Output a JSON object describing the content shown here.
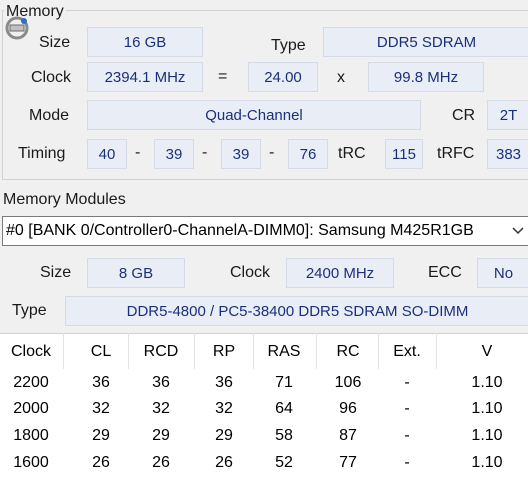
{
  "memory": {
    "title": "Memory",
    "size_label": "Size",
    "size_value": "16 GB",
    "type_label": "Type",
    "type_value": "DDR5 SDRAM",
    "clock_label": "Clock",
    "clock_value": "2394.1 MHz",
    "equals": "=",
    "multiplier": "24.00",
    "times": "x",
    "bus": "99.8 MHz",
    "mode_label": "Mode",
    "mode_value": "Quad-Channel",
    "cr_label": "CR",
    "cr_value": "2T",
    "timing_label": "Timing",
    "timings": [
      "40",
      "39",
      "39",
      "76"
    ],
    "dash": "-",
    "trc_label": "tRC",
    "trc_value": "115",
    "trfc_label": "tRFC",
    "trfc_value": "383"
  },
  "modules": {
    "title": "Memory Modules",
    "selected": "#0 [BANK 0/Controller0-ChannelA-DIMM0]: Samsung M425R1GB",
    "size_label": "Size",
    "size_value": "8 GB",
    "clock_label": "Clock",
    "clock_value": "2400 MHz",
    "ecc_label": "ECC",
    "ecc_value": "No",
    "type_label": "Type",
    "type_value": "DDR5-4800 / PC5-38400 DDR5 SDRAM SO-DIMM"
  },
  "timing_table": {
    "headers": [
      "Clock",
      "CL",
      "RCD",
      "RP",
      "RAS",
      "RC",
      "Ext.",
      "V"
    ],
    "rows": [
      [
        "2200",
        "36",
        "36",
        "36",
        "71",
        "106",
        "-",
        "1.10"
      ],
      [
        "2000",
        "32",
        "32",
        "32",
        "64",
        "96",
        "-",
        "1.10"
      ],
      [
        "1800",
        "29",
        "29",
        "29",
        "58",
        "87",
        "-",
        "1.10"
      ],
      [
        "1600",
        "26",
        "26",
        "26",
        "52",
        "77",
        "-",
        "1.10"
      ]
    ]
  }
}
